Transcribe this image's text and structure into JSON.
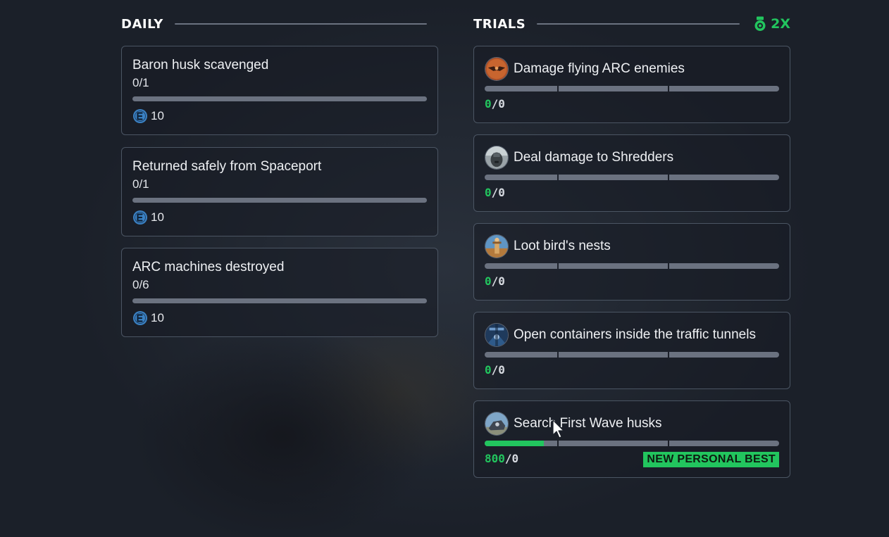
{
  "daily": {
    "title": "DAILY",
    "items": [
      {
        "title": "Baron husk scavenged",
        "progress": "0/1",
        "progress_fraction": 0,
        "reward": "10",
        "reward_icon": "coin-icon"
      },
      {
        "title": "Returned safely from Spaceport",
        "progress": "0/1",
        "progress_fraction": 0,
        "reward": "10",
        "reward_icon": "coin-icon"
      },
      {
        "title": "ARC machines destroyed",
        "progress": "0/6",
        "progress_fraction": 0,
        "reward": "10",
        "reward_icon": "coin-icon"
      }
    ]
  },
  "trials": {
    "title": "TRIALS",
    "multiplier": "2X",
    "multiplier_icon": "medal-icon",
    "items": [
      {
        "title": "Damage flying ARC enemies",
        "current": "0",
        "separator": "/",
        "target": "0",
        "progress_fraction": 0,
        "icon": "flying-arc-icon"
      },
      {
        "title": "Deal damage to Shredders",
        "current": "0",
        "separator": "/",
        "target": "0",
        "progress_fraction": 0,
        "icon": "shredder-icon"
      },
      {
        "title": "Loot bird's nests",
        "current": "0",
        "separator": "/",
        "target": "0",
        "progress_fraction": 0,
        "icon": "birds-nest-icon"
      },
      {
        "title": "Open containers inside the traffic tunnels",
        "current": "0",
        "separator": "/",
        "target": "0",
        "progress_fraction": 0,
        "icon": "tunnel-icon"
      },
      {
        "title": "Search First Wave husks",
        "current": "800",
        "separator": "/",
        "target": "0",
        "progress_fraction": 0.2,
        "icon": "husk-icon",
        "badge": "NEW PERSONAL BEST"
      }
    ]
  },
  "colors": {
    "accent_green": "#22c55e",
    "coin_blue": "#3b82c4",
    "bar_gray": "#6b7280",
    "border_gray": "#4b5563"
  }
}
